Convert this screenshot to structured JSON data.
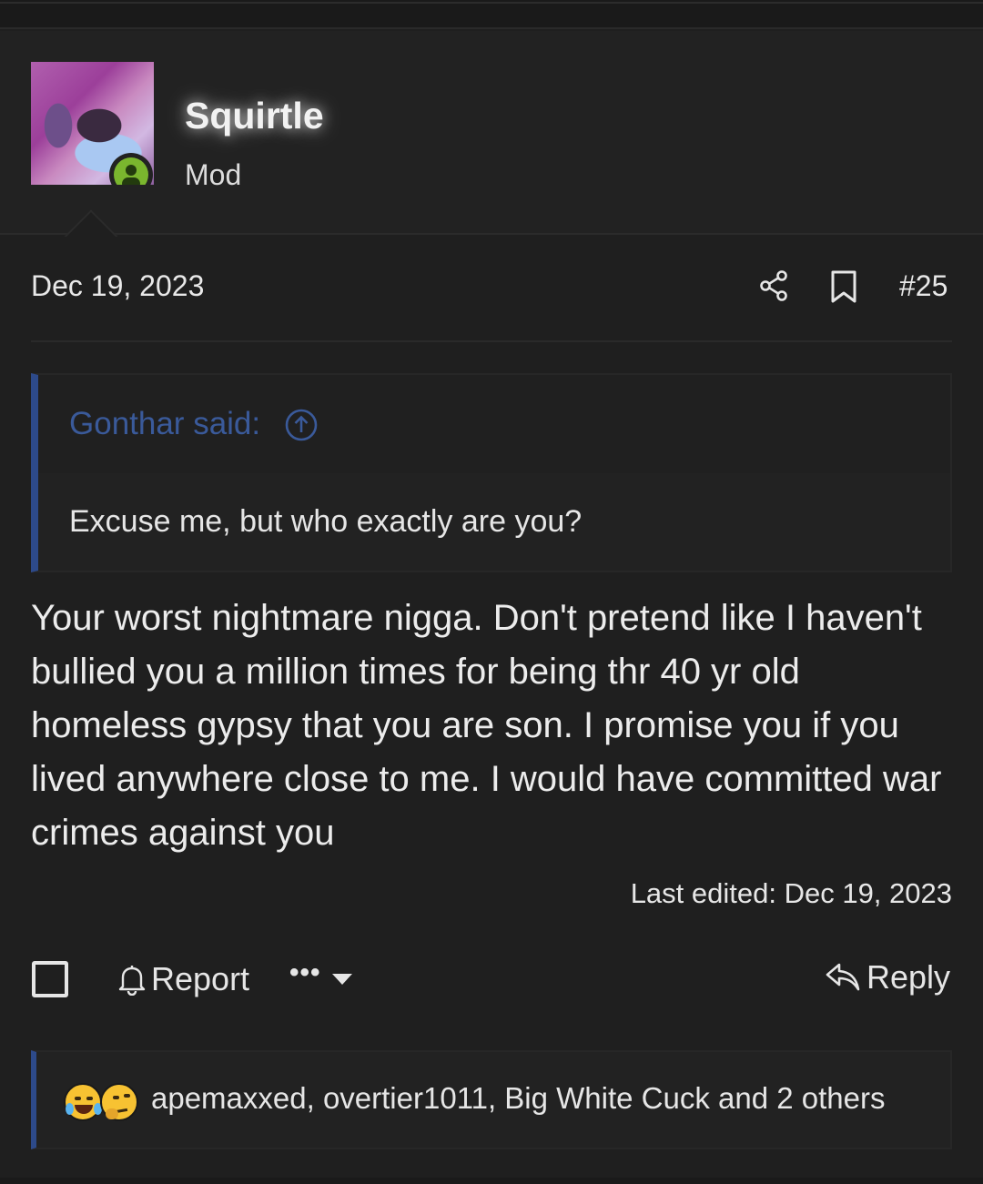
{
  "user": {
    "name": "Squirtle",
    "title": "Mod"
  },
  "post": {
    "date": "Dec 19, 2023",
    "number": "#25",
    "quote": {
      "author": "Gonthar said:",
      "text": "Excuse me, but who exactly are you?"
    },
    "body": "Your worst nightmare nigga. Don't pretend like I haven't bullied you a million times for being thr 40 yr old homeless gypsy that you are son. I promise you if you lived anywhere close to me. I would have committed war crimes against you",
    "last_edited": "Last edited: Dec 19, 2023"
  },
  "actions": {
    "report_label": "Report",
    "more_label": "•••",
    "reply_label": "Reply"
  },
  "reactions": {
    "emojis": [
      "face-with-tears-of-joy",
      "thinking-face"
    ],
    "users_text": "apemaxxed, overtier1011, Big White Cuck and 2 others"
  },
  "colors": {
    "background": "#1f1f1f",
    "quote_accent": "#2d4a8a",
    "online": "#7ab62e"
  },
  "icons": [
    "share-icon",
    "bookmark-icon",
    "arrow-up-circle-icon",
    "bell-icon",
    "reply-icon",
    "online-status-icon"
  ]
}
